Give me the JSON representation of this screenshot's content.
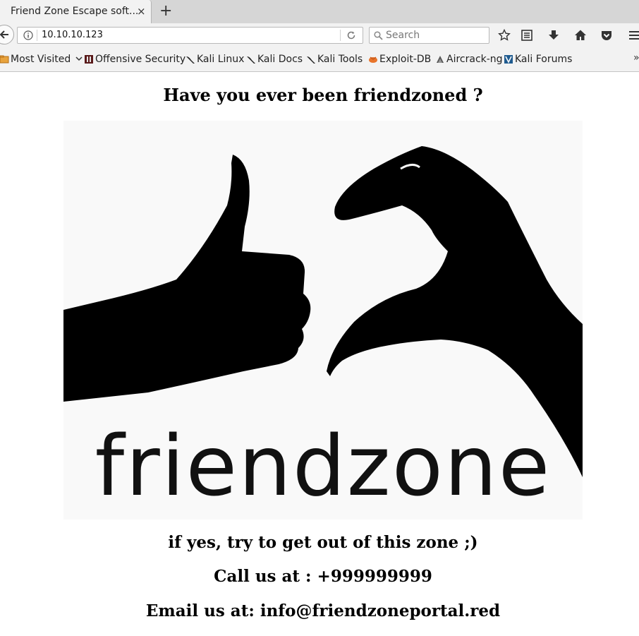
{
  "browser": {
    "tab_title": "Friend Zone Escape soft...",
    "tab_close": "×",
    "new_tab": "+",
    "url": "10.10.10.123",
    "search_placeholder": "Search"
  },
  "bookmarks": [
    {
      "label": "Most Visited",
      "icon": "folder-icon"
    },
    {
      "label": "Offensive Security",
      "icon": "offsec-icon"
    },
    {
      "label": "Kali Linux",
      "icon": "kali-dragon-icon"
    },
    {
      "label": "Kali Docs",
      "icon": "kali-dragon-icon"
    },
    {
      "label": "Kali Tools",
      "icon": "kali-dragon-icon"
    },
    {
      "label": "Exploit-DB",
      "icon": "exploitdb-icon"
    },
    {
      "label": "Aircrack-ng",
      "icon": "aircrack-icon"
    },
    {
      "label": "Kali Forums",
      "icon": "kali-forums-icon"
    }
  ],
  "page": {
    "heading": "Have you ever been friendzoned ?",
    "image_text": "friendzone",
    "line1": "if yes, try to get out of this zone ;)",
    "line2": "Call us at : +999999999",
    "line3": "Email us at: info@friendzoneportal.red"
  }
}
